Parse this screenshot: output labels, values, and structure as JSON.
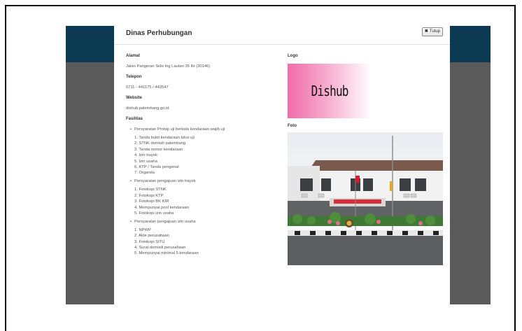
{
  "modal": {
    "title": "Dinas Perhubungan",
    "close_label": "Tutup",
    "close_icon": "close-icon"
  },
  "info": {
    "alamat_label": "Alamat",
    "alamat_value": "Jalan Pangeran Sido Ing Lautan 35 Ilir (30146)",
    "telepon_label": "Telepon",
    "telepon_value": "0711 - 441175 / 442547",
    "website_label": "Website",
    "website_value": "dishub.palembang.go.id",
    "fasilitas_label": "Fasilitas"
  },
  "fasilitas": [
    {
      "title": "Persyaratan Protap uji berkala kendaraan wajib uji",
      "items": [
        "1. Tanda bukti kendaraan lulus uji",
        "2. STNK domisili palembang",
        "3. Tanda nomor kendaraan",
        "4. Izin trayek",
        "5. Izin usaha",
        "6. KTP / Tanda pengenal",
        "7. Organda"
      ]
    },
    {
      "title": "Persyaratan pengajuan izin trayek",
      "items": [
        "1. Fotokopi STNK",
        "2. Fotokopi KTP",
        "3. Fotokopi BK KIR",
        "4. Mempunyai pool kendaraan",
        "5. Fotokopi izin usaha"
      ]
    },
    {
      "title": "Persyaratan pengajuan izin usaha",
      "items": [
        "1. NPWP",
        "2. Akte perusahaan",
        "3. Fotokopi SITU",
        "4. Surat domisili perusahaan",
        "5. Mempunyai minimal 5 kendaraan"
      ]
    }
  ],
  "logo": {
    "label": "Logo",
    "text": "Dishub"
  },
  "foto": {
    "label": "Foto"
  },
  "colors": {
    "header_band": "#0b3a52",
    "overlay": "#5a5a5a",
    "logo_pink": "#f06ca8"
  }
}
